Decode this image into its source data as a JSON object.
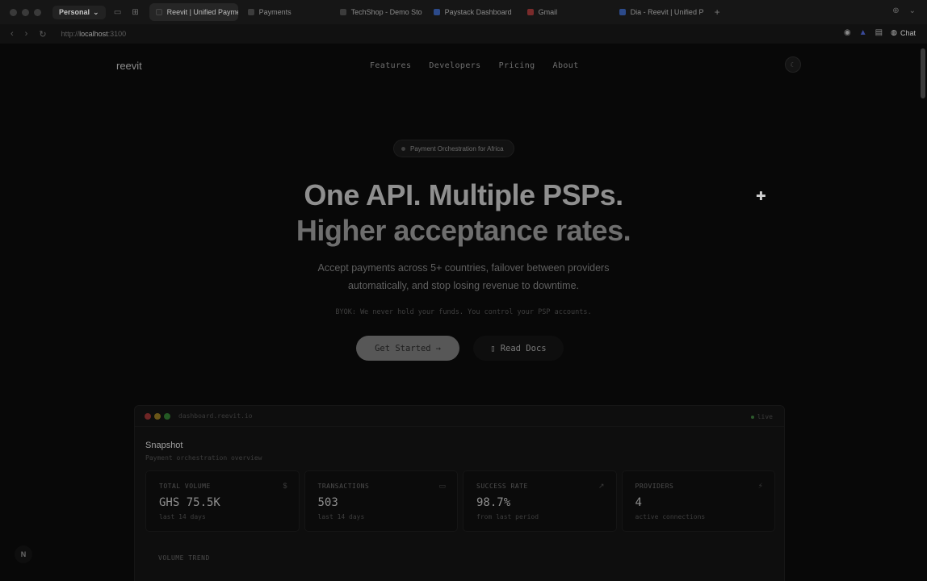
{
  "browser": {
    "profile": "Personal",
    "tabs": [
      {
        "label": "Reevit | Unified Payme",
        "active": true,
        "fav": "dark"
      },
      {
        "label": "Payments",
        "active": false,
        "fav": "plain"
      },
      {
        "label": "TechShop - Demo Sto",
        "active": false,
        "fav": "plain"
      },
      {
        "label": "Paystack Dashboard",
        "active": false,
        "fav": "blue"
      },
      {
        "label": "Gmail",
        "active": false,
        "fav": "red"
      },
      {
        "label": "Dia - Reevit | Unified P",
        "active": false,
        "fav": "blue"
      }
    ],
    "url_scheme": "http://",
    "url_host": "localhost",
    "url_port": ":3100",
    "chat_label": "Chat"
  },
  "site": {
    "logo": "reevit",
    "nav": [
      "Features",
      "Developers",
      "Pricing",
      "About"
    ],
    "theme_toggle": "☾"
  },
  "hero": {
    "badge": "Payment Orchestration for Africa",
    "title_line1": "One API. Multiple PSPs.",
    "title_line2": "Higher acceptance rates.",
    "subtitle_line1": "Accept payments across 5+ countries, failover between providers",
    "subtitle_line2": "automatically, and stop losing revenue to downtime.",
    "note": "BYOK: We never hold your funds. You control your PSP accounts.",
    "primary_cta": "Get Started",
    "secondary_cta": "Read Docs"
  },
  "dashboard": {
    "window_title": "dashboard.reevit.io",
    "live_label": "live",
    "title": "Snapshot",
    "subtitle": "Payment orchestration overview",
    "stats": [
      {
        "label": "TOTAL VOLUME",
        "value": "GHS 75.5K",
        "caption": "last 14 days",
        "icon": "$"
      },
      {
        "label": "TRANSACTIONS",
        "value": "503",
        "caption": "last 14 days",
        "icon": "▭"
      },
      {
        "label": "SUCCESS RATE",
        "value": "98.7%",
        "caption": "from last period",
        "icon": "↗"
      },
      {
        "label": "PROVIDERS",
        "value": "4",
        "caption": "active connections",
        "icon": "⚡"
      }
    ],
    "trend_label": "VOLUME TREND"
  },
  "dev_badge": "N"
}
